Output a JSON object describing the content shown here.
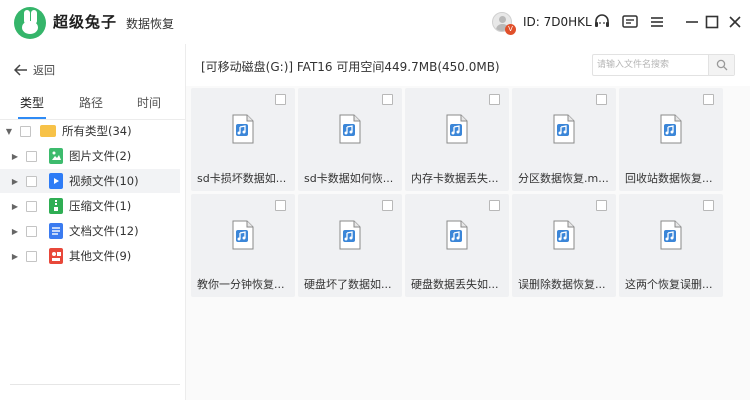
{
  "app": {
    "brand": "超级兔子",
    "subtitle": "数据恢复",
    "user_id": "ID: 7D0HKL",
    "vip_badge": "V"
  },
  "toolbar_icons": [
    "support-icon",
    "feedback-icon",
    "menu-icon",
    "minimize-icon",
    "maximize-icon",
    "close-icon"
  ],
  "sidebar": {
    "back_label": "返回",
    "tabs": [
      "类型",
      "路径",
      "时间"
    ],
    "active_tab": "类型",
    "tree": [
      {
        "label": "所有类型(34)",
        "icon": "folder-icon",
        "color": "#f7c248",
        "expanded": true,
        "level": 0
      },
      {
        "label": "图片文件(2)",
        "icon": "image-file-icon",
        "color": "#3dbb6d",
        "level": 1
      },
      {
        "label": "视频文件(10)",
        "icon": "video-file-icon",
        "color": "#2e7cf6",
        "level": 1,
        "selected": true
      },
      {
        "label": "压缩文件(1)",
        "icon": "archive-file-icon",
        "color": "#2fae54",
        "level": 1
      },
      {
        "label": "文档文件(12)",
        "icon": "document-file-icon",
        "color": "#3b7bf0",
        "level": 1
      },
      {
        "label": "其他文件(9)",
        "icon": "other-file-icon",
        "color": "#e8483a",
        "level": 1
      }
    ]
  },
  "main": {
    "path": "[可移动磁盘(G:)] FAT16 可用空间449.7MB(450.0MB)",
    "search_placeholder": "请输入文件名搜索",
    "files": [
      "sd卡损坏数据如...",
      "sd卡数据如何恢...",
      "内存卡数据丢失...",
      "分区数据恢复.m...",
      "回收站数据恢复...",
      "教你一分钟恢复...",
      "硬盘坏了数据如...",
      "硬盘数据丢失如...",
      "误删除数据恢复...",
      "这两个恢复误删..."
    ]
  },
  "colors": {
    "accent": "#2f8bf5",
    "logo": "#35b56a",
    "card_bg": "#f0f1f3"
  }
}
